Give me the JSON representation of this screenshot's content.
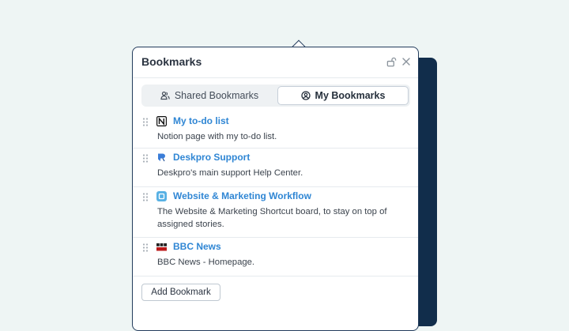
{
  "panel": {
    "title": "Bookmarks",
    "header_icons": [
      "unlock-icon",
      "close-icon"
    ]
  },
  "tabs": [
    {
      "label": "Shared Bookmarks",
      "icon": "users-icon",
      "selected": false
    },
    {
      "label": "My Bookmarks",
      "icon": "user-circle-icon",
      "selected": true
    }
  ],
  "bookmarks": [
    {
      "title": "My to-do list",
      "description": "Notion page with my to-do list.",
      "icon": "notion-icon"
    },
    {
      "title": "Deskpro Support",
      "description": "Deskpro's main support Help Center.",
      "icon": "deskpro-icon"
    },
    {
      "title": "Website & Marketing Workflow",
      "description": "The Website & Marketing Shortcut board, to stay on top of assigned stories.",
      "icon": "shortcut-icon"
    },
    {
      "title": "BBC News",
      "description": "BBC News - Homepage.",
      "icon": "bbc-news-icon"
    }
  ],
  "add_button": {
    "label": "Add Bookmark"
  },
  "colors": {
    "background": "#eef5f4",
    "dark_panel": "#112d4b",
    "link": "#2f86d4",
    "border": "#233c5c"
  }
}
